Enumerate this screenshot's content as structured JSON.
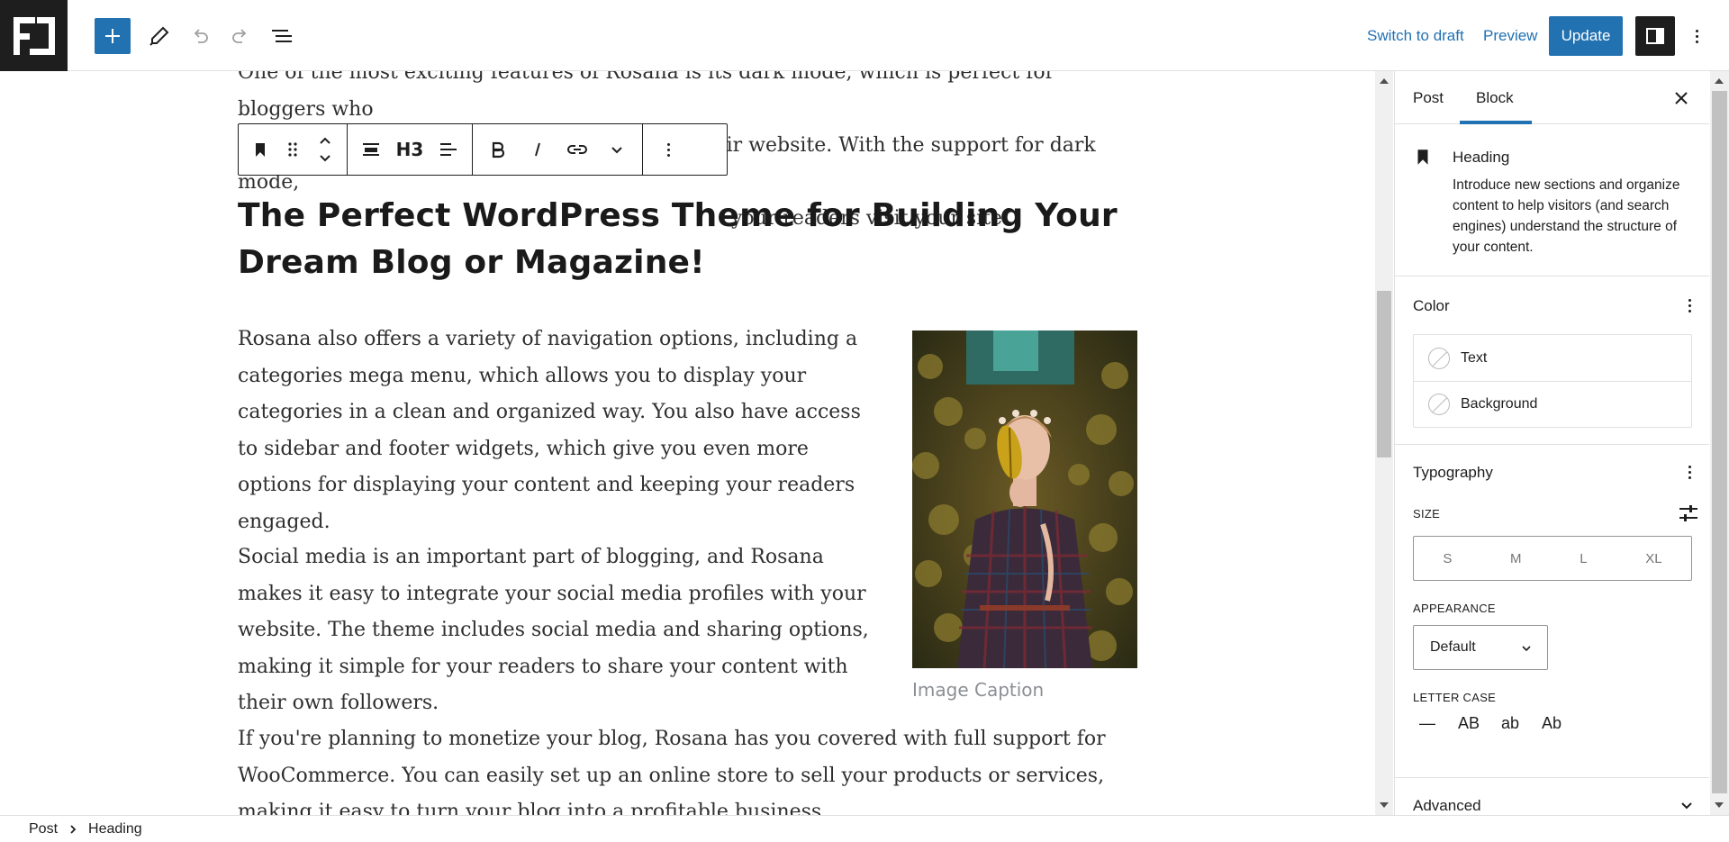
{
  "topbar": {
    "switch_to_draft": "Switch to draft",
    "preview": "Preview",
    "update": "Update",
    "accent": "#2271b1"
  },
  "block_toolbar": {
    "heading_level": "H3"
  },
  "content": {
    "clipped_paragraph_lines": [
      "One of the most exciting features of Rosana is its dark mode, which is perfect for bloggers who",
      "want to create a unique and modern look for their website. With the support for dark mode,",
      "your readers visit your site."
    ],
    "heading": "The Perfect WordPress Theme for Building Your Dream Blog or Magazine!",
    "paragraph_navigation": "Rosana also offers a variety of navigation options, including a categories mega menu, which allows you to display your categories in a clean and organized way. You also have access to sidebar and footer widgets, which give you even more options for displaying your content and keeping your readers engaged.",
    "paragraph_social": "Social media is an important part of blogging, and Rosana makes it easy to integrate your social media profiles with your website. The theme includes social media and sharing options, making it simple for your readers to share your content with their own followers.",
    "paragraph_woocommerce": "If you're planning to monetize your blog, Rosana has you covered with full support for WooCommerce. You can easily set up an online store to sell your products or services, making it easy to turn your blog into a profitable business.",
    "image_caption": "Image Caption"
  },
  "sidebar": {
    "tabs": [
      "Post",
      "Block"
    ],
    "active_tab": "Block",
    "block_card": {
      "title": "Heading",
      "description": "Introduce new sections and organize content to help visitors (and search engines) understand the structure of your content."
    },
    "color": {
      "title": "Color",
      "items": [
        "Text",
        "Background"
      ]
    },
    "typography": {
      "title": "Typography",
      "size_label": "SIZE",
      "sizes": [
        "S",
        "M",
        "L",
        "XL"
      ],
      "appearance_label": "APPEARANCE",
      "appearance_value": "Default",
      "letter_case_label": "LETTER CASE",
      "letter_cases": [
        "—",
        "AB",
        "ab",
        "Ab"
      ]
    },
    "advanced": {
      "title": "Advanced"
    }
  },
  "breadcrumb": {
    "items": [
      "Post",
      "Heading"
    ]
  }
}
